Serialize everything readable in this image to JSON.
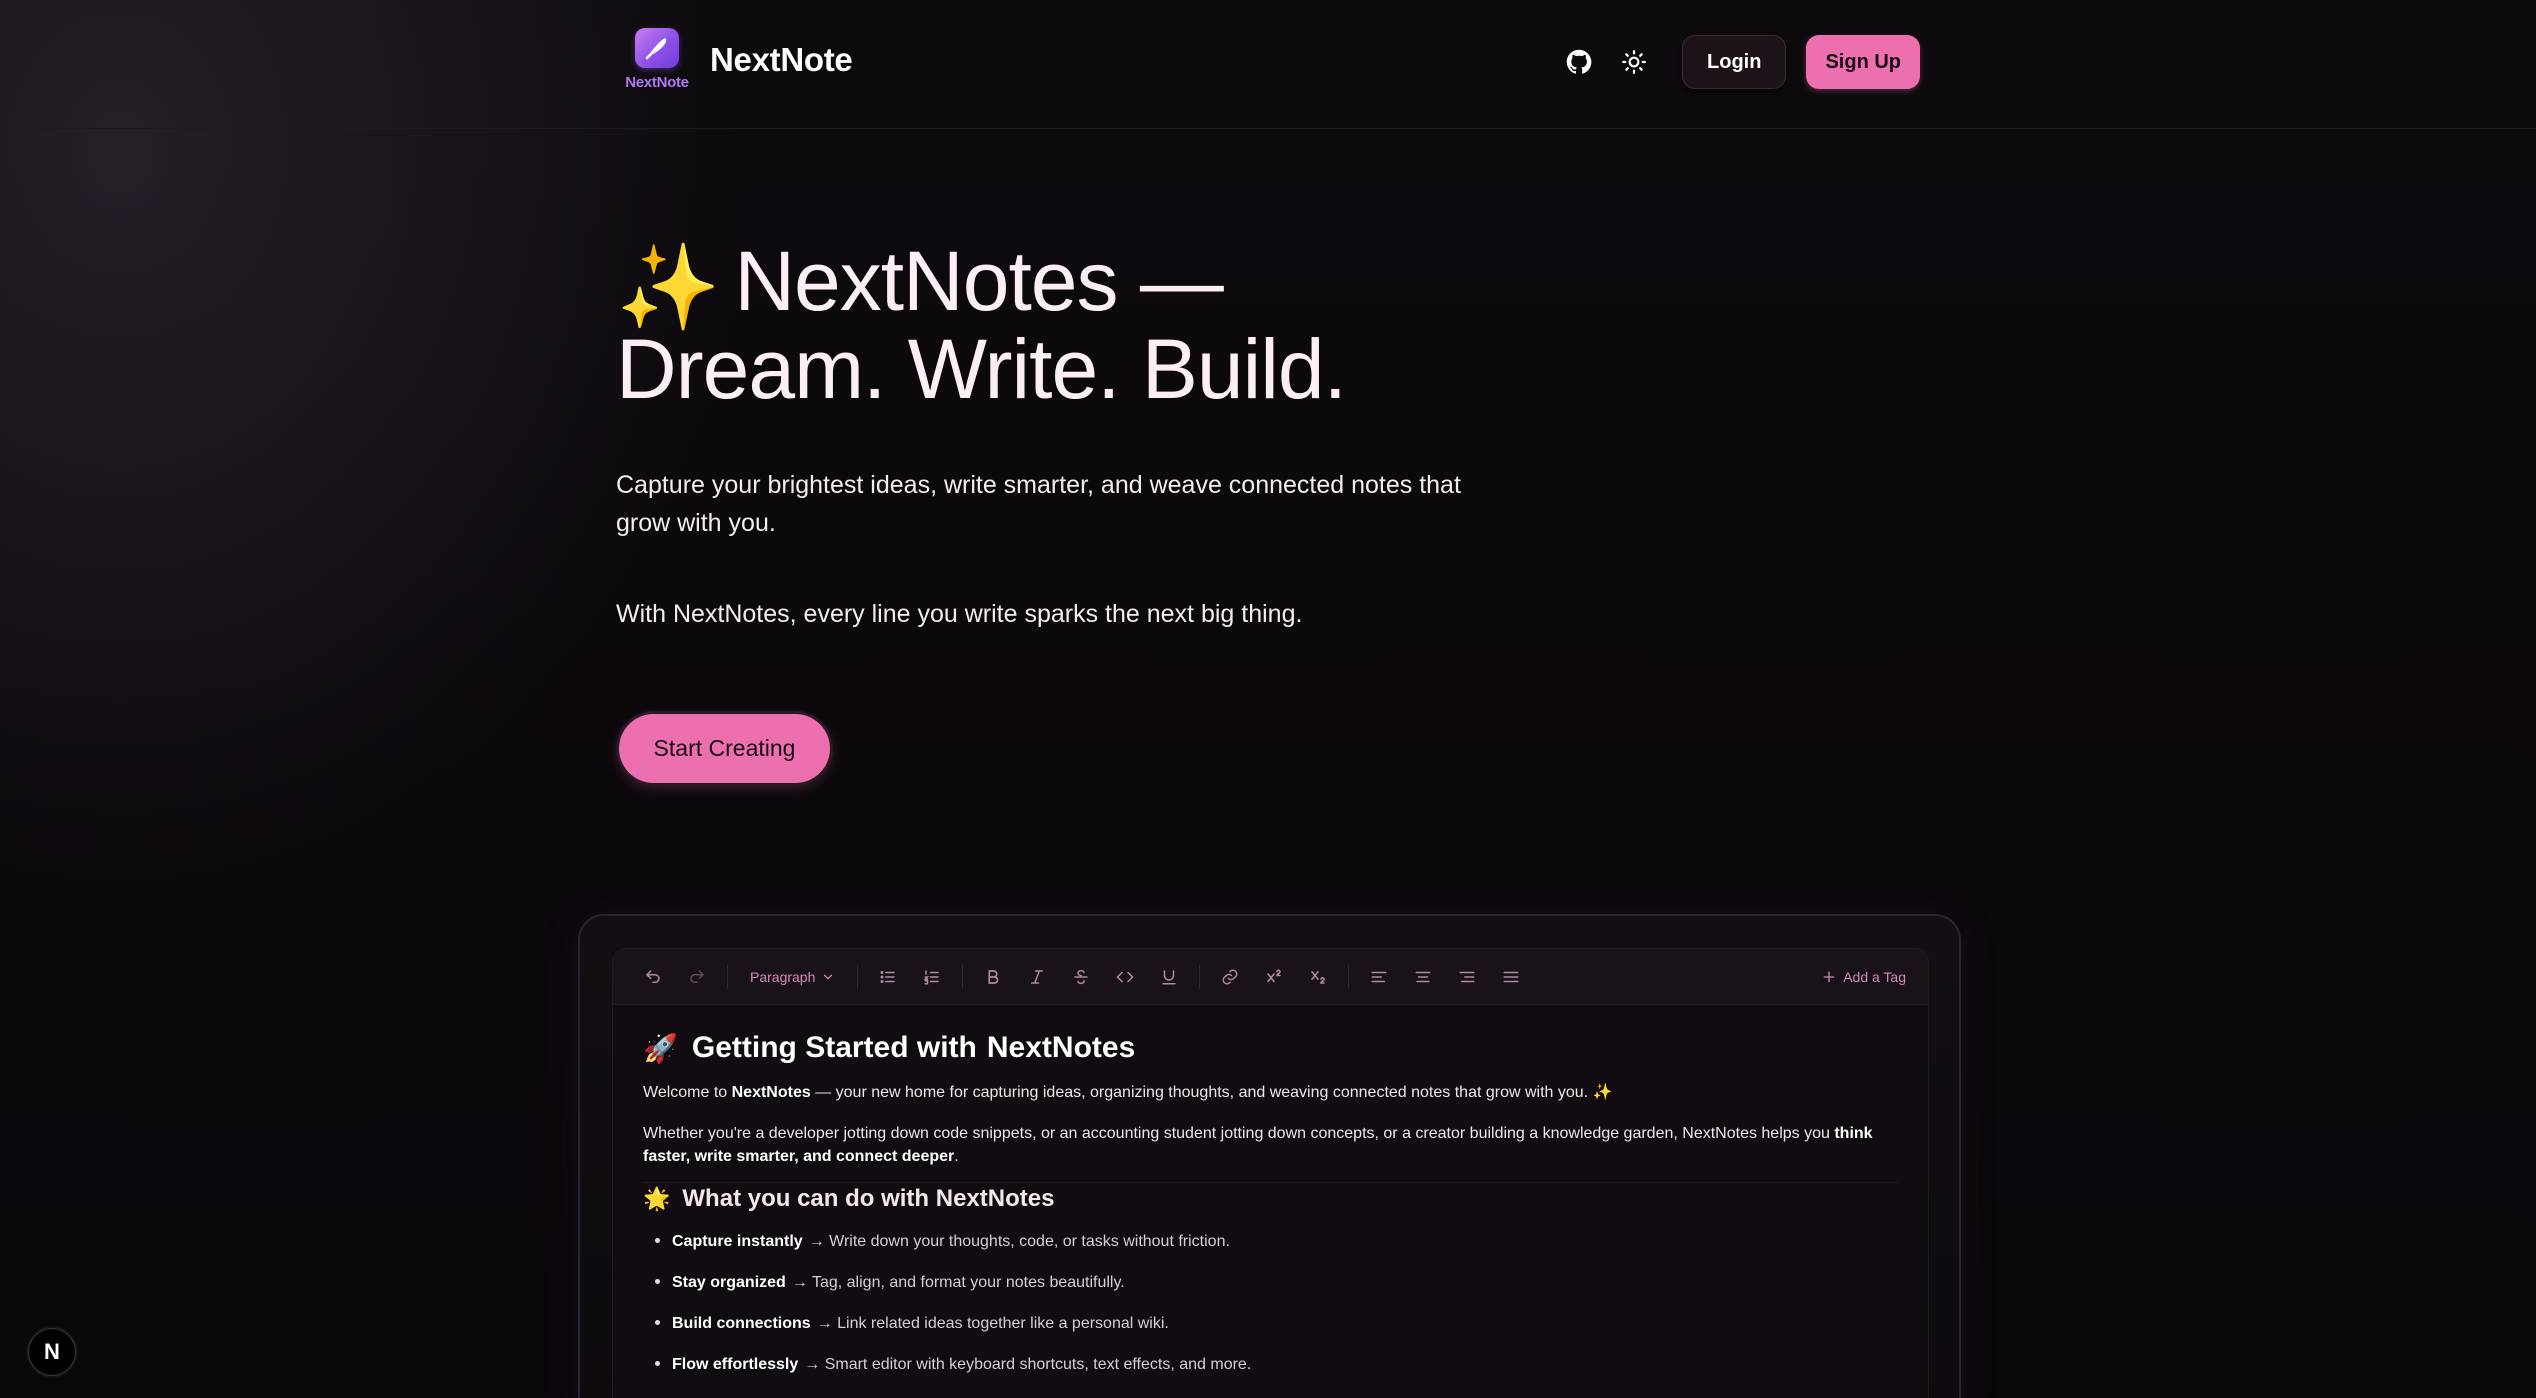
{
  "brand": {
    "logo_label": "NextNote",
    "name": "NextNote"
  },
  "nav": {
    "github_icon": "github-icon",
    "theme_icon": "sun-icon",
    "login_label": "Login",
    "signup_label": "Sign Up"
  },
  "hero": {
    "sparkle": "✨",
    "title_line1": "NextNotes —",
    "title_line2": "Dream. Write. Build.",
    "subtitle": "Capture your brightest ideas, write smarter, and weave connected notes that grow with you.",
    "subtitle2": "With NextNotes, every line you write sparks the next big thing.",
    "cta_label": "Start Creating"
  },
  "editor": {
    "toolbar": {
      "block_type": "Paragraph",
      "add_tag_label": "Add a Tag"
    },
    "doc": {
      "h1_emoji": "🚀",
      "h1_text": "Getting Started with",
      "h1_bold": "NextNotes",
      "p1_pre": "Welcome to ",
      "p1_bold": "NextNotes",
      "p1_post": " — your new home for capturing ideas, organizing thoughts, and weaving connected notes that grow with you. ✨",
      "p2_pre": "Whether you're a developer jotting down code snippets, or an accounting student jotting down concepts, or a creator building a knowledge garden, NextNotes helps you ",
      "p2_bold": "think faster, write smarter, and connect deeper",
      "p2_post": ".",
      "h2_emoji": "🌟",
      "h2_text": "What you can do with NextNotes",
      "features": [
        {
          "title": "Capture instantly",
          "desc": "→ Write down your thoughts, code, or tasks without friction."
        },
        {
          "title": "Stay organized",
          "desc": "→ Tag, align, and format your notes beautifully."
        },
        {
          "title": "Build connections",
          "desc": "→ Link related ideas together like a personal wiki."
        },
        {
          "title": "Flow effortlessly",
          "desc": "→ Smart editor with keyboard shortcuts, text effects, and more."
        }
      ]
    }
  },
  "dev_badge": "N"
}
